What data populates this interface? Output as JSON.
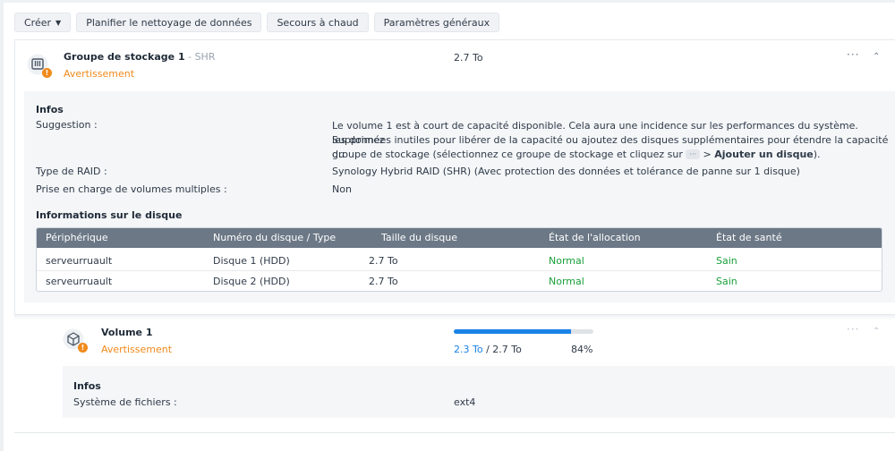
{
  "toolbar": {
    "create": "Créer",
    "schedule_scrub": "Planifier le nettoyage de données",
    "hot_spare": "Secours à chaud",
    "general_settings": "Paramètres généraux"
  },
  "pool": {
    "name": "Groupe de stockage 1",
    "raid_suffix": " - SHR",
    "status": "Avertissement",
    "capacity": "2.7 To",
    "more": "···",
    "collapse": "⌃",
    "infos_heading": "Infos",
    "suggestion_label": "Suggestion :",
    "suggestion_line1": "Le volume 1 est à court de capacité disponible. Cela aura une incidence sur les performances du système. Supprimez",
    "suggestion_line2": "les données inutiles pour libérer de la capacité ou ajoutez des disques supplémentaires pour étendre la capacité du",
    "suggestion_line3_pre": "groupe de stockage (sélectionnez ce groupe de stockage et cliquez sur ",
    "suggestion_kbd": "···",
    "suggestion_line3_mid": " > ",
    "suggestion_line3_bold": "Ajouter un disque",
    "suggestion_line3_post": ").",
    "raid_label": "Type de RAID :",
    "raid_value": "Synology Hybrid RAID (SHR) (Avec protection des données et tolérance de panne sur 1 disque)",
    "multi_vol_label": "Prise en charge de volumes multiples :",
    "multi_vol_value": "Non",
    "disk_info_heading": "Informations sur le disque",
    "table": {
      "headers": [
        "Périphérique",
        "Numéro du disque / Type",
        "Taille du disque",
        "État de l'allocation",
        "État de santé"
      ],
      "rows": [
        [
          "serveurruault",
          "Disque 1 (HDD)",
          "2.7 To",
          "Normal",
          "Sain"
        ],
        [
          "serveurruault",
          "Disque 2 (HDD)",
          "2.7 To",
          "Normal",
          "Sain"
        ]
      ]
    }
  },
  "volume": {
    "name": "Volume 1",
    "status": "Avertissement",
    "used": "2.3 To",
    "separator": " / ",
    "total": "2.7 To",
    "percent": "84%",
    "usage_fraction": 0.84,
    "more": "···",
    "collapse": "⌃",
    "infos_heading": "Infos",
    "fs_label": "Système de fichiers :",
    "fs_value": "ext4"
  },
  "colors": {
    "warning": "#f08a1c",
    "healthy": "#1aa03a",
    "accent": "#1a82e6",
    "table_header": "#6c7886"
  }
}
